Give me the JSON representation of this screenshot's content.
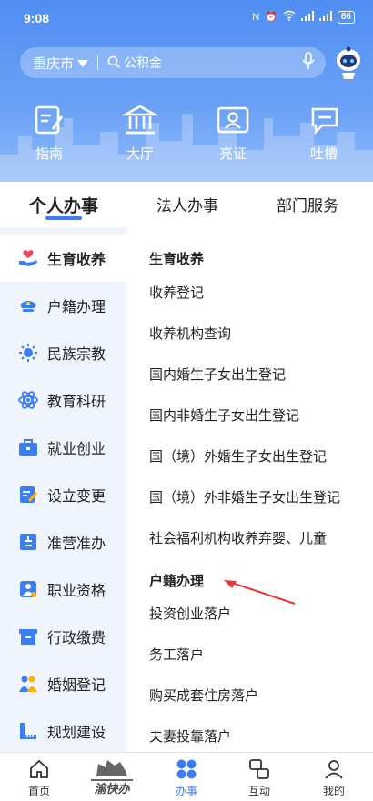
{
  "status_bar": {
    "time": "9:08",
    "battery": "86"
  },
  "search": {
    "city": "重庆市",
    "placeholder": "公积金"
  },
  "quick_links": [
    {
      "label": "指南",
      "icon": "guide-icon"
    },
    {
      "label": "大厅",
      "icon": "hall-icon"
    },
    {
      "label": "亮证",
      "icon": "id-card-icon"
    },
    {
      "label": "吐槽",
      "icon": "feedback-icon"
    }
  ],
  "tabs": [
    {
      "label": "个人办事",
      "active": true
    },
    {
      "label": "法人办事",
      "active": false
    },
    {
      "label": "部门服务",
      "active": false
    }
  ],
  "sidebar": [
    {
      "label": "生育收养",
      "icon": "hand-heart-icon",
      "active": true
    },
    {
      "label": "户籍办理",
      "icon": "police-cap-icon",
      "active": false
    },
    {
      "label": "民族宗教",
      "icon": "sun-icon",
      "active": false
    },
    {
      "label": "教育科研",
      "icon": "atom-icon",
      "active": false
    },
    {
      "label": "就业创业",
      "icon": "briefcase-icon",
      "active": false
    },
    {
      "label": "设立变更",
      "icon": "edit-document-icon",
      "active": false
    },
    {
      "label": "准营准办",
      "icon": "permit-icon",
      "active": false
    },
    {
      "label": "职业资格",
      "icon": "certificate-person-icon",
      "active": false
    },
    {
      "label": "行政缴费",
      "icon": "fee-box-icon",
      "active": false
    },
    {
      "label": "婚姻登记",
      "icon": "couple-icon",
      "active": false
    },
    {
      "label": "规划建设",
      "icon": "ruler-icon",
      "active": false
    }
  ],
  "content": {
    "sections": [
      {
        "title": "生育收养",
        "items": [
          "收养登记",
          "收养机构查询",
          "国内婚生子女出生登记",
          "国内非婚生子女出生登记",
          "国（境）外婚生子女出生登记",
          "国（境）外非婚生子女出生登记",
          "社会福利机构收养弃婴、儿童"
        ]
      },
      {
        "title": "户籍办理",
        "items": [
          "投资创业落户",
          "务工落户",
          "购买成套住房落户",
          "夫妻投靠落户"
        ]
      }
    ]
  },
  "bottom_nav": [
    {
      "label": "首页",
      "icon": "home-icon",
      "active": false
    },
    {
      "label": "渝快办",
      "icon": "yukuaiban-logo",
      "active": false
    },
    {
      "label": "办事",
      "icon": "services-grid-icon",
      "active": true
    },
    {
      "label": "互动",
      "icon": "interact-icon",
      "active": false
    },
    {
      "label": "我的",
      "icon": "profile-icon",
      "active": false
    }
  ],
  "colors": {
    "brand": "#3b7df2",
    "annotation_arrow": "#e53935",
    "sidebar_bg": "#f0f5fd"
  }
}
